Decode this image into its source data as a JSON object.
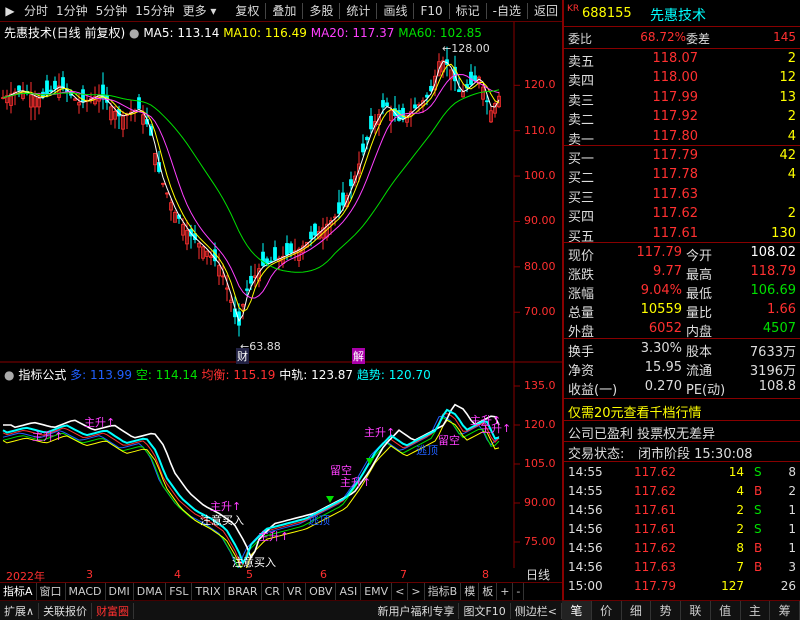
{
  "toolbar": {
    "left": [
      "分时",
      "1分钟",
      "5分钟",
      "15分钟",
      "更多"
    ],
    "right": [
      "复权",
      "叠加",
      "多股",
      "统计",
      "画线",
      "F10",
      "标记",
      "-自选",
      "返回"
    ]
  },
  "main_header": {
    "title": "先惠技术(日线 前复权)",
    "ma5": "MA5: 113.14",
    "ma10": "MA10: 116.49",
    "ma20": "MA20: 117.37",
    "ma60": "MA60: 102.85"
  },
  "main_annotations": {
    "high_label": "128.00",
    "low_label": "63.88",
    "marker_cai": "财",
    "marker_jie": "解"
  },
  "indicator_header": {
    "name": "指标公式",
    "duo": "多: 113.99",
    "kong": "空: 114.14",
    "junheng": "均衡: 115.19",
    "zhonggui": "中轨: 123.87",
    "qushi": "趋势: 120.70"
  },
  "indicator_annotations": [
    {
      "text": "主升↑",
      "color": "#ff40ff"
    },
    {
      "text": "主升↑",
      "color": "#ff40ff"
    },
    {
      "text": "注意买入",
      "color": "#ffffff"
    },
    {
      "text": "主升↑",
      "color": "#ff40ff"
    },
    {
      "text": "主升↑",
      "color": "#ff40ff"
    },
    {
      "text": "逃顶",
      "color": "#2060ff"
    },
    {
      "text": "留空",
      "color": "#ff40ff"
    },
    {
      "text": "主升↑",
      "color": "#ff40ff"
    },
    {
      "text": "主升↑",
      "color": "#ff40ff"
    },
    {
      "text": "逃顶",
      "color": "#2060ff"
    },
    {
      "text": "留空",
      "color": "#ff40ff"
    },
    {
      "text": "主升↑",
      "color": "#ff40ff"
    },
    {
      "text": "主升↑",
      "color": "#ff40ff"
    },
    {
      "text": "注意买入",
      "color": "#ffffff"
    }
  ],
  "x_axis": {
    "labels": [
      "2022年",
      "3",
      "4",
      "5",
      "6",
      "7",
      "8"
    ],
    "corner": "日线"
  },
  "main_y_ticks": [
    "120.0",
    "110.0",
    "100.0",
    "90.00",
    "80.00",
    "70.00"
  ],
  "ind_y_ticks": [
    "135.0",
    "120.0",
    "105.0",
    "90.00",
    "75.00"
  ],
  "tabs": [
    "指标A",
    "窗口",
    "MACD",
    "DMI",
    "DMA",
    "FSL",
    "TRIX",
    "BRAR",
    "CR",
    "VR",
    "OBV",
    "ASI",
    "EMV",
    "<",
    ">",
    "指标B",
    "模",
    "板",
    "+",
    "-"
  ],
  "statusbar": [
    "扩展∧",
    "关联报价",
    "财富圈",
    "新用户福利专享",
    "图文F10",
    "侧边栏<"
  ],
  "quote": {
    "badge": "KR",
    "code": "688155",
    "name": "先惠技术",
    "weibi_label": "委比",
    "weibi": "68.72%",
    "weicha_label": "委差",
    "weicha": "145",
    "sell": [
      {
        "label": "卖五",
        "price": "118.07",
        "vol": "2"
      },
      {
        "label": "卖四",
        "price": "118.00",
        "vol": "12"
      },
      {
        "label": "卖三",
        "price": "117.99",
        "vol": "13"
      },
      {
        "label": "卖二",
        "price": "117.92",
        "vol": "2"
      },
      {
        "label": "卖一",
        "price": "117.80",
        "vol": "4"
      }
    ],
    "buy": [
      {
        "label": "买一",
        "price": "117.79",
        "vol": "42"
      },
      {
        "label": "买二",
        "price": "117.78",
        "vol": "4"
      },
      {
        "label": "买三",
        "price": "117.63",
        "vol": ""
      },
      {
        "label": "买四",
        "price": "117.62",
        "vol": "2"
      },
      {
        "label": "买五",
        "price": "117.61",
        "vol": "130"
      }
    ],
    "stats": [
      {
        "l1": "现价",
        "v1": "117.79",
        "c1": "#ff3030",
        "l2": "今开",
        "v2": "108.02",
        "c2": "#ffffff"
      },
      {
        "l1": "涨跌",
        "v1": "9.77",
        "c1": "#ff3030",
        "l2": "最高",
        "v2": "118.79",
        "c2": "#ff3030"
      },
      {
        "l1": "涨幅",
        "v1": "9.04%",
        "c1": "#ff3030",
        "l2": "最低",
        "v2": "106.69",
        "c2": "#00e000"
      },
      {
        "l1": "总量",
        "v1": "10559",
        "c1": "#ffff00",
        "l2": "量比",
        "v2": "1.66",
        "c2": "#ff3030"
      },
      {
        "l1": "外盘",
        "v1": "6052",
        "c1": "#ff3030",
        "l2": "内盘",
        "v2": "4507",
        "c2": "#00e000"
      }
    ],
    "stats2": [
      {
        "l1": "换手",
        "v1": "3.30%",
        "l2": "股本",
        "v2": "7633万"
      },
      {
        "l1": "净资",
        "v1": "15.95",
        "l2": "流通",
        "v2": "3196万"
      },
      {
        "l1": "收益(一)",
        "v1": "0.270",
        "l2": "PE(动)",
        "v2": "108.8"
      }
    ],
    "promo": "仅需20元查看千档行情",
    "notice": "公司已盈利 投票权无差异",
    "trade_state_label": "交易状态:",
    "trade_state": "闭市阶段 15:30:08",
    "ticks": [
      {
        "time": "14:55",
        "price": "117.62",
        "vol": "14",
        "bs": "S",
        "n": "8"
      },
      {
        "time": "14:55",
        "price": "117.62",
        "vol": "4",
        "bs": "B",
        "n": "2"
      },
      {
        "time": "14:56",
        "price": "117.61",
        "vol": "2",
        "bs": "S",
        "n": "1"
      },
      {
        "time": "14:56",
        "price": "117.61",
        "vol": "2",
        "bs": "S",
        "n": "1"
      },
      {
        "time": "14:56",
        "price": "117.62",
        "vol": "8",
        "bs": "B",
        "n": "1"
      },
      {
        "time": "14:56",
        "price": "117.63",
        "vol": "7",
        "bs": "B",
        "n": "3"
      },
      {
        "time": "15:00",
        "price": "117.79",
        "vol": "127",
        "bs": "",
        "n": "26"
      }
    ]
  },
  "right_tabs": [
    "笔",
    "价",
    "细",
    "势",
    "联",
    "值",
    "主",
    "筹"
  ],
  "colors": {
    "up": "#ff3030",
    "down": "#00e000",
    "flat": "#00ffff",
    "ma5": "#ffffff",
    "ma10": "#ffff00",
    "ma20": "#ff40ff",
    "ma60": "#00e000",
    "border": "#800000"
  }
}
